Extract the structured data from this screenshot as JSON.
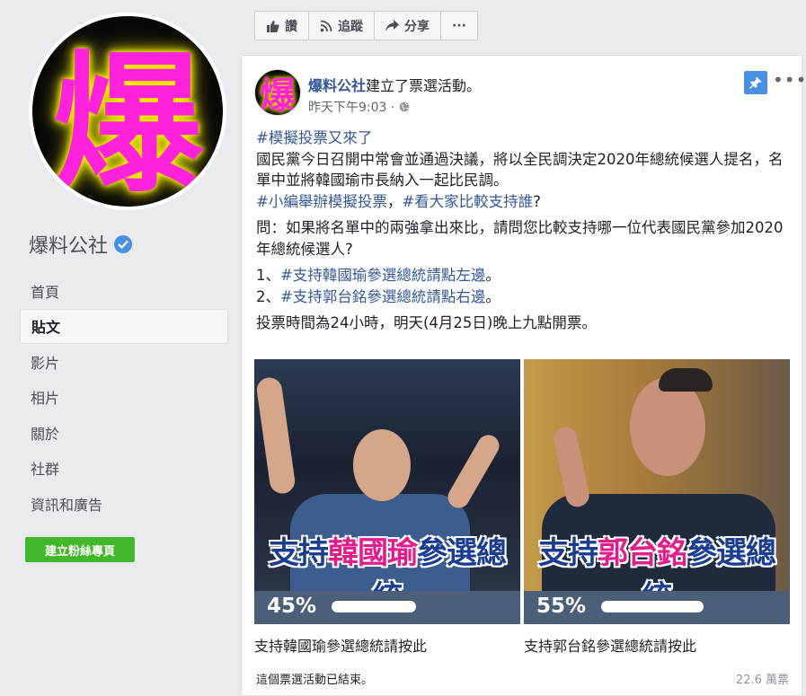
{
  "page": {
    "avatar_glyph": "爆",
    "name": "爆料公社",
    "nav": [
      "首頁",
      "貼文",
      "影片",
      "相片",
      "關於",
      "社群",
      "資訊和廣告"
    ],
    "active_nav": "貼文",
    "create_button": "建立粉絲專頁"
  },
  "actions": {
    "like": "讚",
    "follow": "追蹤",
    "share": "分享",
    "more": "···"
  },
  "post": {
    "author": "爆料公社",
    "action_text": "建立了票選活動。",
    "time": "昨天下午9:03 ·",
    "avatar_glyph": "爆",
    "hashtag1": "#模擬投票又來了",
    "line1": "國民黨今日召開中常會並通過決議，將以全民調決定2020年總統候選人提名，名單中並將韓國瑜市長納入一起比民調。",
    "hashtag2": "#小編舉辦模擬投票",
    "comma": "，",
    "hashtag3": "#看大家比較支持誰",
    "qmark": "?",
    "question": "問：如果將名單中的兩強拿出來比，請問您比較支持哪一位代表國民黨參加2020年總統候選人?",
    "opt1_prefix": "1、",
    "opt1_tag": "#支持韓國瑜參選總統請點左邊",
    "opt1_suffix": "。",
    "opt2_prefix": "2、",
    "opt2_tag": "#支持郭台銘參選總統請點右邊",
    "opt2_suffix": "。",
    "deadline": "投票時間為24小時，明天(4月25日)晚上九點開票。"
  },
  "poll": {
    "options": [
      {
        "caption_pre": "支持",
        "caption_hl": "韓國瑜",
        "caption_post": "參選總統",
        "percent": "45%",
        "share": 0.45,
        "label": "支持韓國瑜參選總統請按此"
      },
      {
        "caption_pre": "支持",
        "caption_hl": "郭台銘",
        "caption_post": "參選總統",
        "percent": "55%",
        "share": 0.55,
        "label": "支持郭台銘參選總統請按此"
      }
    ],
    "ended": "這個票選活動已結束。",
    "votes": "22.6 萬票"
  },
  "colors": {
    "link": "#365899",
    "green": "#42b72a",
    "verified": "#4a90e2",
    "highlight": "#e01e8c"
  }
}
